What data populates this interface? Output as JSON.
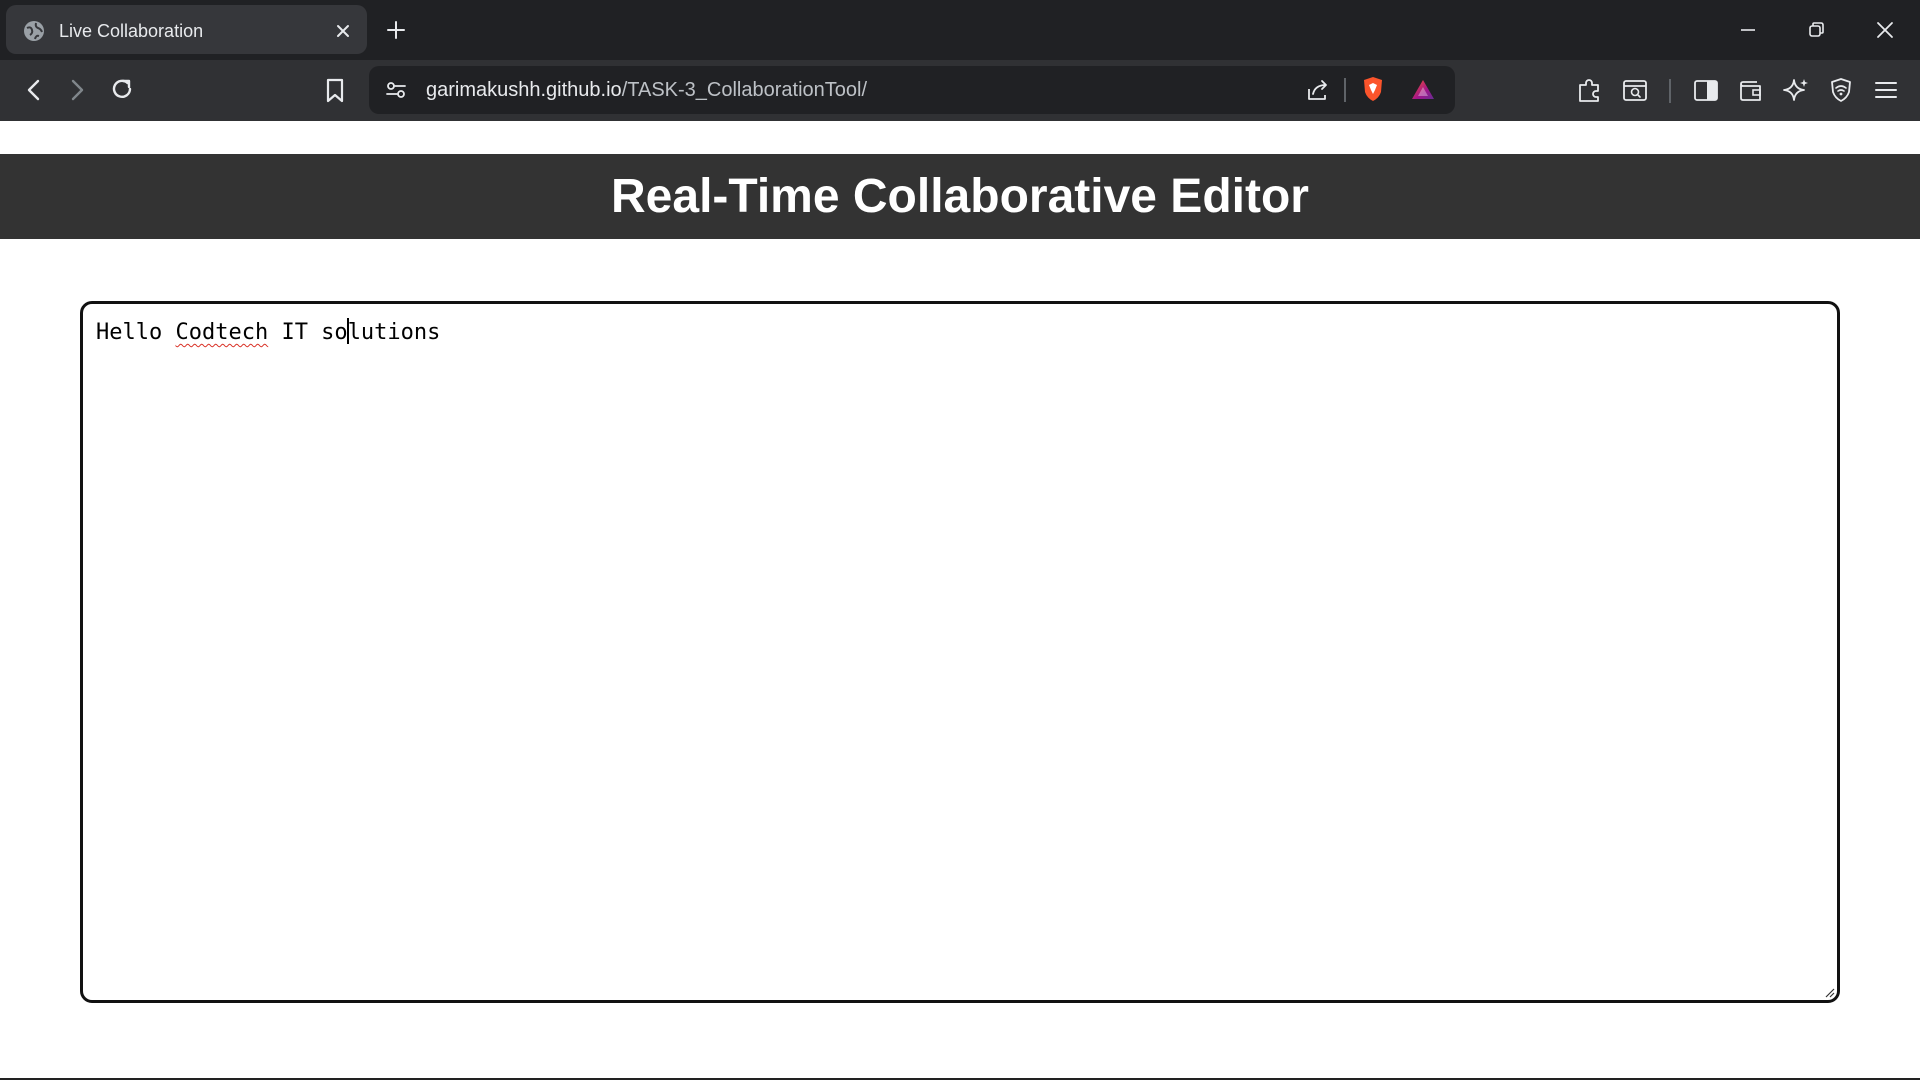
{
  "browser": {
    "tab": {
      "title": "Live Collaboration",
      "favicon": "globe-icon",
      "close_icon": "close-icon"
    },
    "new_tab_icon": "plus-icon",
    "window_controls": [
      "minimize-icon",
      "restore-icon",
      "close-icon"
    ],
    "address_bar": {
      "url_host": "garimakushh.github.io",
      "url_path": "/TASK-3_CollaborationTool/"
    },
    "nav_icons": [
      "back-icon",
      "forward-icon",
      "reload-icon",
      "bookmark-icon",
      "site-settings-icon"
    ],
    "toolbar_icons": [
      "share-icon",
      "brave-shields-icon",
      "brave-rewards-icon",
      "extensions-icon",
      "reader-mode-icon",
      "sidebar-icon",
      "wallet-icon",
      "leo-ai-icon",
      "vpn-icon",
      "menu-icon"
    ],
    "colors": {
      "tabstrip": "#202124",
      "toolbar": "#303134",
      "brave_orange": "#fb542b"
    }
  },
  "page": {
    "header": {
      "title": "Real-Time Collaborative Editor",
      "background": "#333333",
      "color": "#ffffff"
    },
    "editor": {
      "text_before_caret_1": "Hello ",
      "misspelled_word": "Codtech",
      "text_middle": " IT so",
      "text_after_caret": "lutions",
      "full_text": "Hello Codtech IT solutions"
    }
  }
}
